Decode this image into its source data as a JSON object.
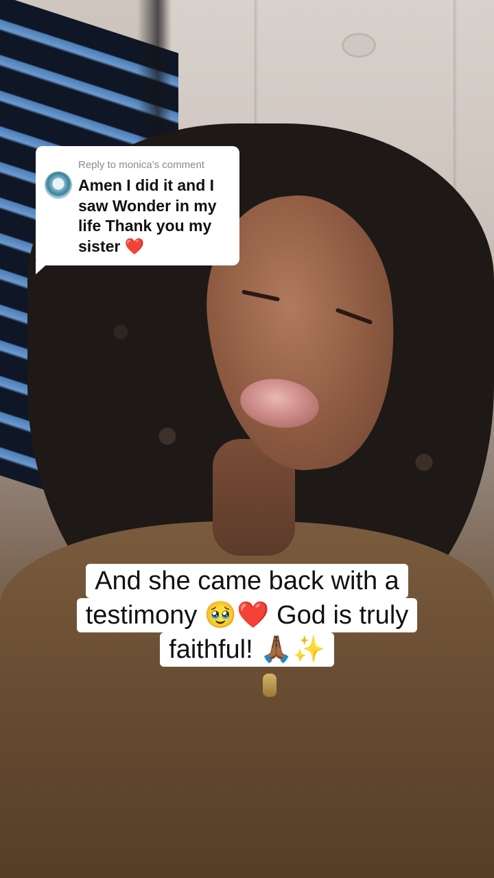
{
  "reply_sticker": {
    "header": "Reply to monica’s comment",
    "comment_lines": [
      "Amen I did it and I",
      "saw Wonder in my",
      "life Thank you my",
      "sister ❤️"
    ]
  },
  "caption": {
    "lines": [
      "And she came back with a",
      "testimony 🥹❤️ God is truly",
      "faithful! 🙏🏾✨"
    ]
  }
}
